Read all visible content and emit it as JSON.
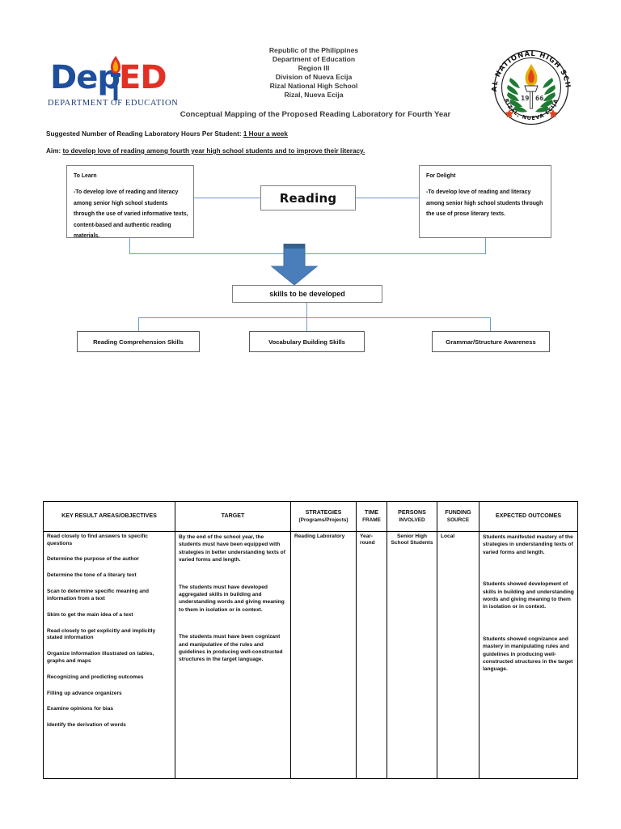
{
  "header": {
    "deped_logo": {
      "dep": "Dep",
      "ed": "ED",
      "subtitle": "DEPARTMENT OF EDUCATION",
      "blue": "#1F4E9C",
      "red": "#E23025"
    },
    "agency_lines": [
      "Republic of the Philippines",
      "Department of Education",
      "Region III",
      "Division of Nueva Ecija",
      "Rizal National High School",
      "Rizal, Nueva Ecija"
    ],
    "document_title": "Conceptual Mapping of the Proposed Reading Laboratory for Fourth Year",
    "school_seal": {
      "arc_top": "RIZAL NATIONAL HIGH SCHOOL",
      "arc_bottom": "RIZAL, NUEVA ECIJA",
      "year_left": "19",
      "year_right": "66"
    }
  },
  "intro": {
    "hours_label": "Suggested Number of Reading Laboratory Hours Per Student: ",
    "hours_value": "1 Hour a week",
    "aim_label": "Aim: ",
    "aim_value": "to develop love of reading among fourth year high school students and to improve their literacy."
  },
  "diagram": {
    "learn_box": {
      "title": "To Learn",
      "body": "-To develop love of reading and literacy among senior high school students through the use of varied informative texts, content-based and authentic reading materials."
    },
    "delight_box": {
      "title": "For Delight",
      "body": "-To develop love of reading and literacy among senior high school students through the use of prose literary texts."
    },
    "center_node": "Reading",
    "skills_node": "skills to be developed",
    "skill_boxes": [
      "Reading Comprehension Skills",
      "Vocabulary Building Skills",
      "Grammar/Structure Awareness"
    ],
    "arrow_color": "#4A7EBB",
    "connector_color": "#6A9AD0",
    "box_border_color": "#7F7F7F"
  },
  "table": {
    "headers": [
      {
        "main": "KEY RESULT AREAS/OBJECTIVES",
        "sub": ""
      },
      {
        "main": "TARGET",
        "sub": ""
      },
      {
        "main": "STRATEGIES",
        "sub": "(Programs/Projects)"
      },
      {
        "main": "TIME",
        "sub": "FRAME"
      },
      {
        "main": "PERSONS",
        "sub": "INVOLVED"
      },
      {
        "main": "FUNDING",
        "sub": "SOURCE"
      },
      {
        "main": "EXPECTED OUTCOMES",
        "sub": ""
      }
    ],
    "objectives": [
      "Read closely to find answers to specific questions",
      "Determine the purpose of the author",
      "Determine the tone of a literary text",
      "Scan to determine specific meaning and information from a text",
      "Skim to get the main idea of a text",
      "Read closely to get explicitly and implicitly stated information",
      "Organize information illustrated on tables, graphs and maps",
      "Recognizing and predicting outcomes",
      "Filling up advance organizers",
      "Examine opinions for bias",
      "Identify the derivation of words"
    ],
    "targets": [
      "By the end of the school year, the students must have been equipped with strategies in better understanding texts of varied forms and length.",
      "The students must have developed aggregated skills in building and understanding words and giving meaning to them in isolation or in context.",
      "The students must have been cognizant and manipulative of the rules and guidelines in producing well-constructed structures in the target language."
    ],
    "strategies": "Reading Laboratory",
    "time_frame": "Year-round",
    "persons_involved": "Senior High School Students",
    "funding_source": "Local",
    "expected_outcomes": [
      "Students manifested mastery of the strategies in understanding texts of varied forms and length.",
      "Students showed development of skills in building and understanding words and giving meaning to them in isolation or in context.",
      "Students showed cognizance and mastery in manipulating rules and guidelines in producing well-constructed structures in the target language."
    ]
  }
}
